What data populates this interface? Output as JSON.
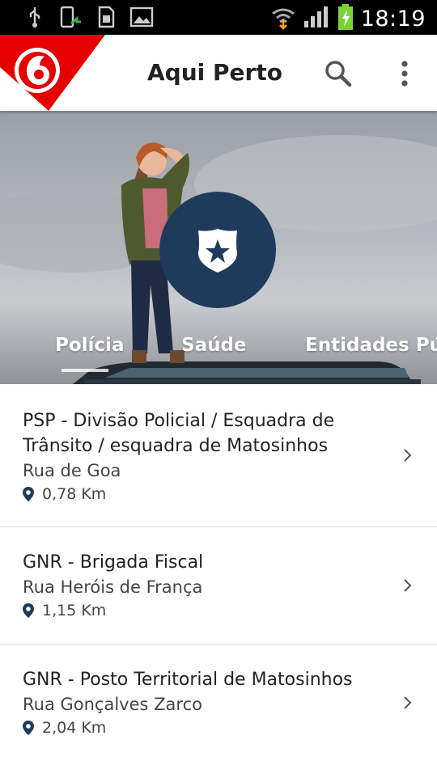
{
  "status_bar": {
    "time": "18:19"
  },
  "app_bar": {
    "title": "Aqui Perto"
  },
  "tabs": [
    {
      "label": "Polícia",
      "selected": true
    },
    {
      "label": "Saúde",
      "selected": false
    },
    {
      "label": "Entidades Públ",
      "selected": false
    }
  ],
  "results": [
    {
      "name_line1": "PSP - Divisão Policial / Esquadra de",
      "name_line2": "Trânsito / esquadra de Matosinhos",
      "address": "Rua de Goa",
      "distance": "0,78 Km"
    },
    {
      "name_line1": "GNR - Brigada Fiscal",
      "address": "Rua Heróis de França",
      "distance": "1,15 Km"
    },
    {
      "name_line1": "GNR - Posto Territorial de Matosinhos",
      "address": "Rua Gonçalves Zarco",
      "distance": "2,04 Km"
    }
  ],
  "colors": {
    "brand_red": "#e60000",
    "badge_navy": "#1e3b5c",
    "status_bar": "#000000"
  }
}
